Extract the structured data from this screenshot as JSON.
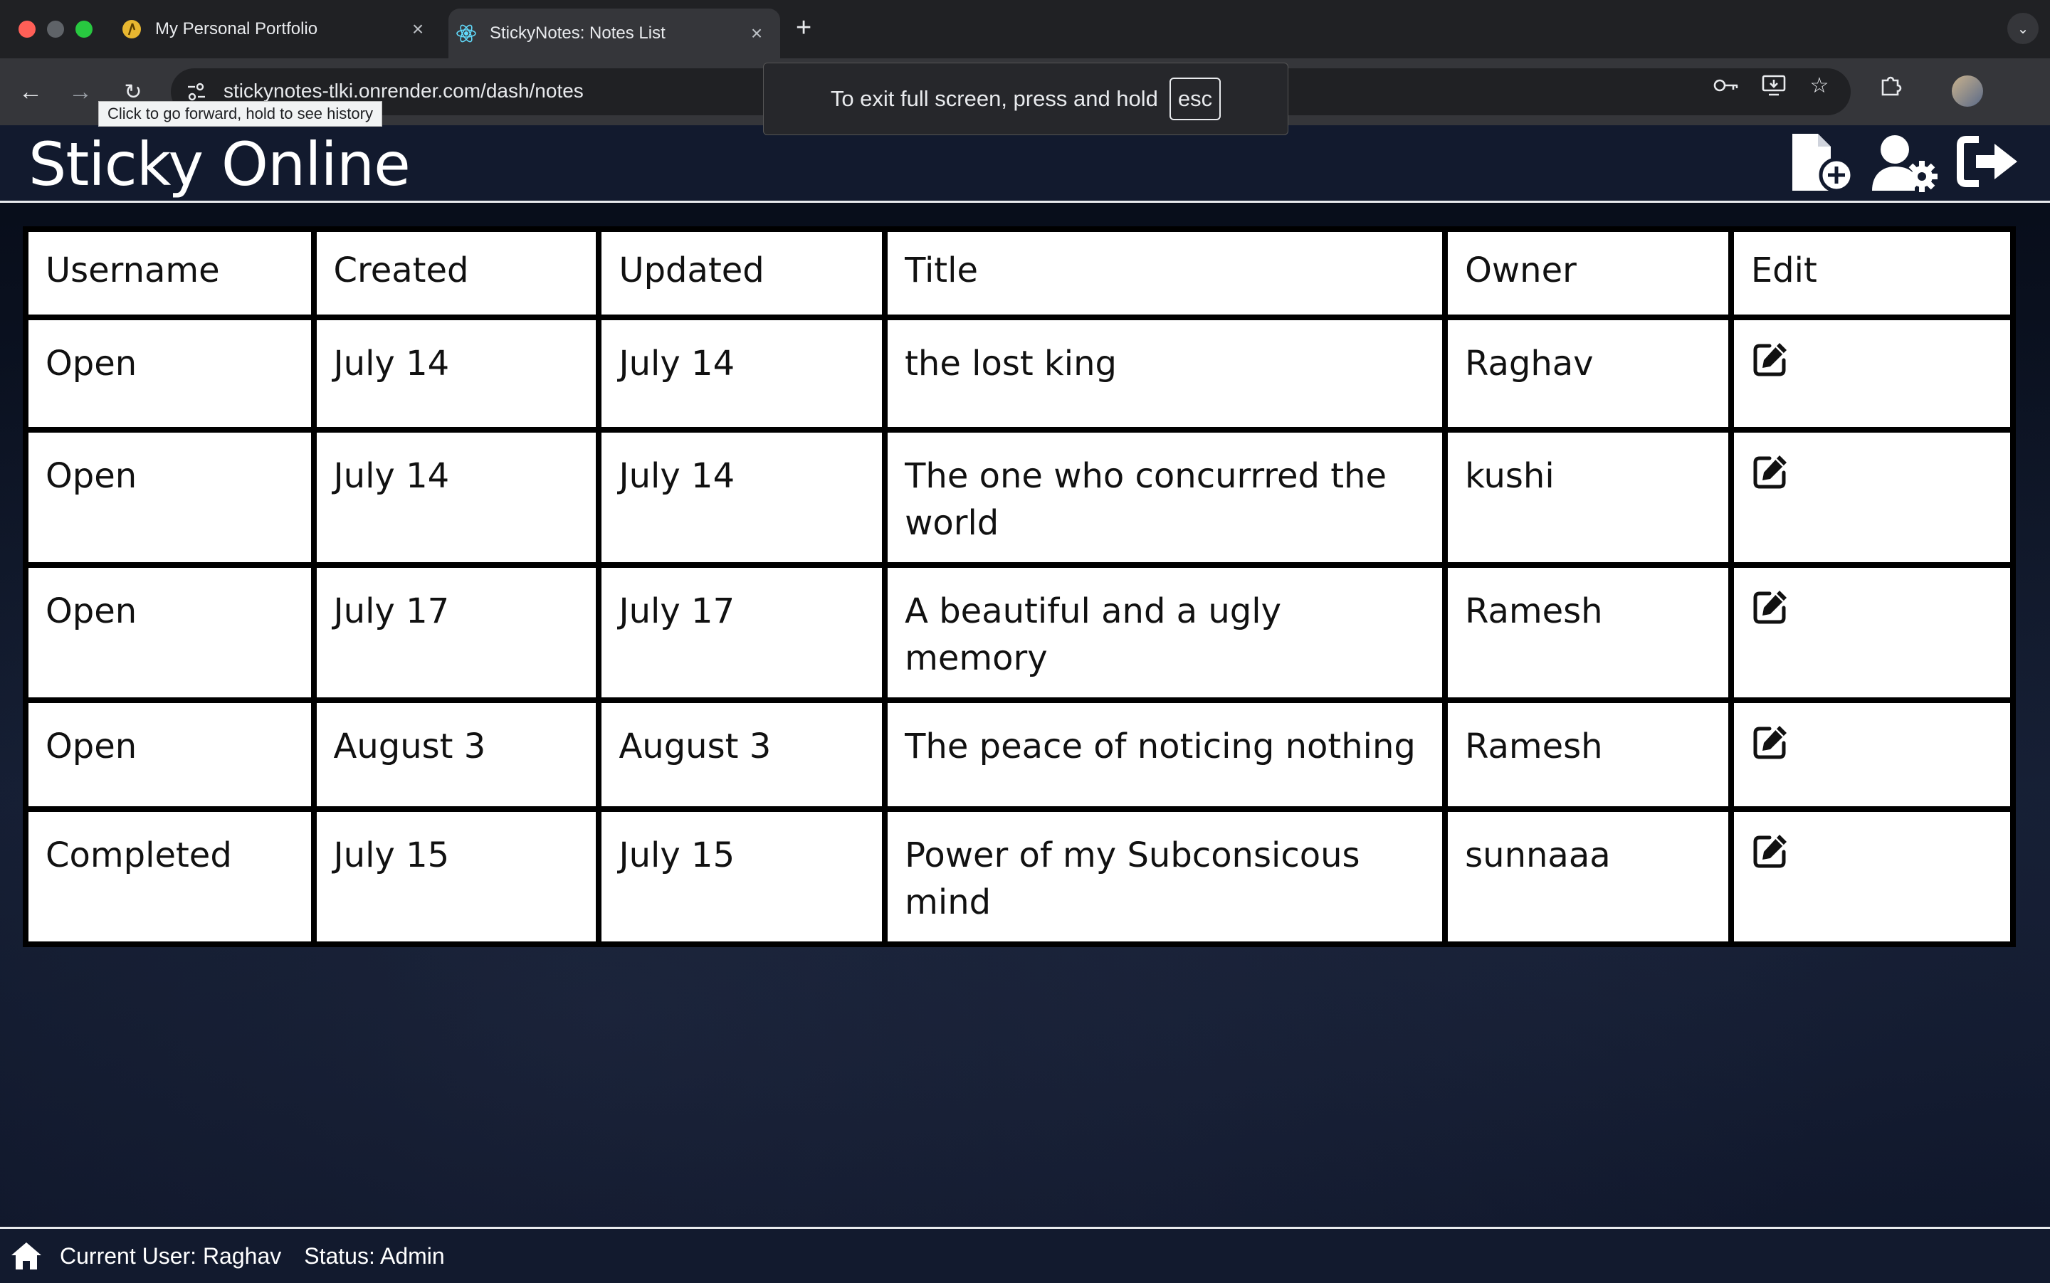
{
  "browser": {
    "tabs": [
      {
        "title": "My Personal Portfolio",
        "active": false
      },
      {
        "title": "StickyNotes: Notes List",
        "active": true
      }
    ],
    "url": "stickynotes-tlki.onrender.com/dash/notes",
    "tooltip": "Click to go forward, hold to see history",
    "fullscreen_notice": {
      "message": "To exit full screen, press and hold",
      "key": "esc"
    }
  },
  "app": {
    "title": "Sticky Online",
    "header_icons": [
      "new-note-icon",
      "user-settings-icon",
      "logout-icon"
    ]
  },
  "table": {
    "headers": [
      "Username",
      "Created",
      "Updated",
      "Title",
      "Owner",
      "Edit"
    ],
    "rows": [
      {
        "status": "Open",
        "created": "July 14",
        "updated": "July 14",
        "title": "the lost king",
        "owner": "Raghav"
      },
      {
        "status": "Open",
        "created": "July 14",
        "updated": "July 14",
        "title": "The one who concurrred the world",
        "owner": "kushi"
      },
      {
        "status": "Open",
        "created": "July 17",
        "updated": "July 17",
        "title": "A beautiful and a ugly memory",
        "owner": "Ramesh"
      },
      {
        "status": "Open",
        "created": "August 3",
        "updated": "August 3",
        "title": "The peace of noticing nothing",
        "owner": "Ramesh"
      },
      {
        "status": "Completed",
        "created": "July 15",
        "updated": "July 15",
        "title": "Power of my Subconsicous mind",
        "owner": "sunnaaa"
      }
    ]
  },
  "footer": {
    "current_user": "Current User: Raghav",
    "status": "Status: Admin"
  },
  "colors": {
    "open": "#a3201c",
    "completed": "#6bc33a",
    "header_bg": "#121a2e"
  }
}
